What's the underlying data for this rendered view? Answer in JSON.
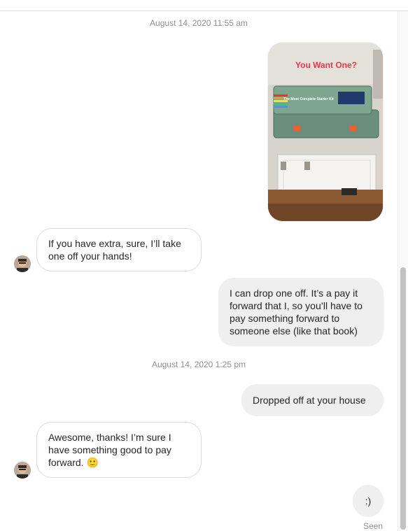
{
  "thread": {
    "timestamp_1": "August 14, 2020 11:55 am",
    "timestamp_2": "August 14, 2020 1:25 pm",
    "story": {
      "overlay_text": "You Want One?",
      "box_label": "The Most Complete Starter Kit"
    },
    "messages": [
      {
        "side": "in",
        "lines": [
          "If you have extra, sure, I’ll take",
          "one off your hands!"
        ]
      },
      {
        "side": "out",
        "lines": [
          "I can drop one off. It’s a pay it",
          "forward that I, so you’ll have to",
          "pay something forward to",
          "someone else (like that book)"
        ]
      },
      {
        "side": "out",
        "lines": [
          "Dropped off at your house"
        ]
      },
      {
        "side": "in",
        "lines": [
          "Awesome, thanks! I’m sure I",
          "have something good to pay",
          "forward. 🙂"
        ]
      },
      {
        "side": "out",
        "lines": [
          ":)"
        ]
      }
    ],
    "seen_label": "Seen"
  },
  "colors": {
    "bubble_outgoing": "#efefef",
    "bubble_incoming_border": "#dbdbdb",
    "meta_text": "#8e8e8e",
    "story_overlay": "#e8354b"
  },
  "icons": [
    "avatar",
    "smiley-emoji-icon"
  ]
}
